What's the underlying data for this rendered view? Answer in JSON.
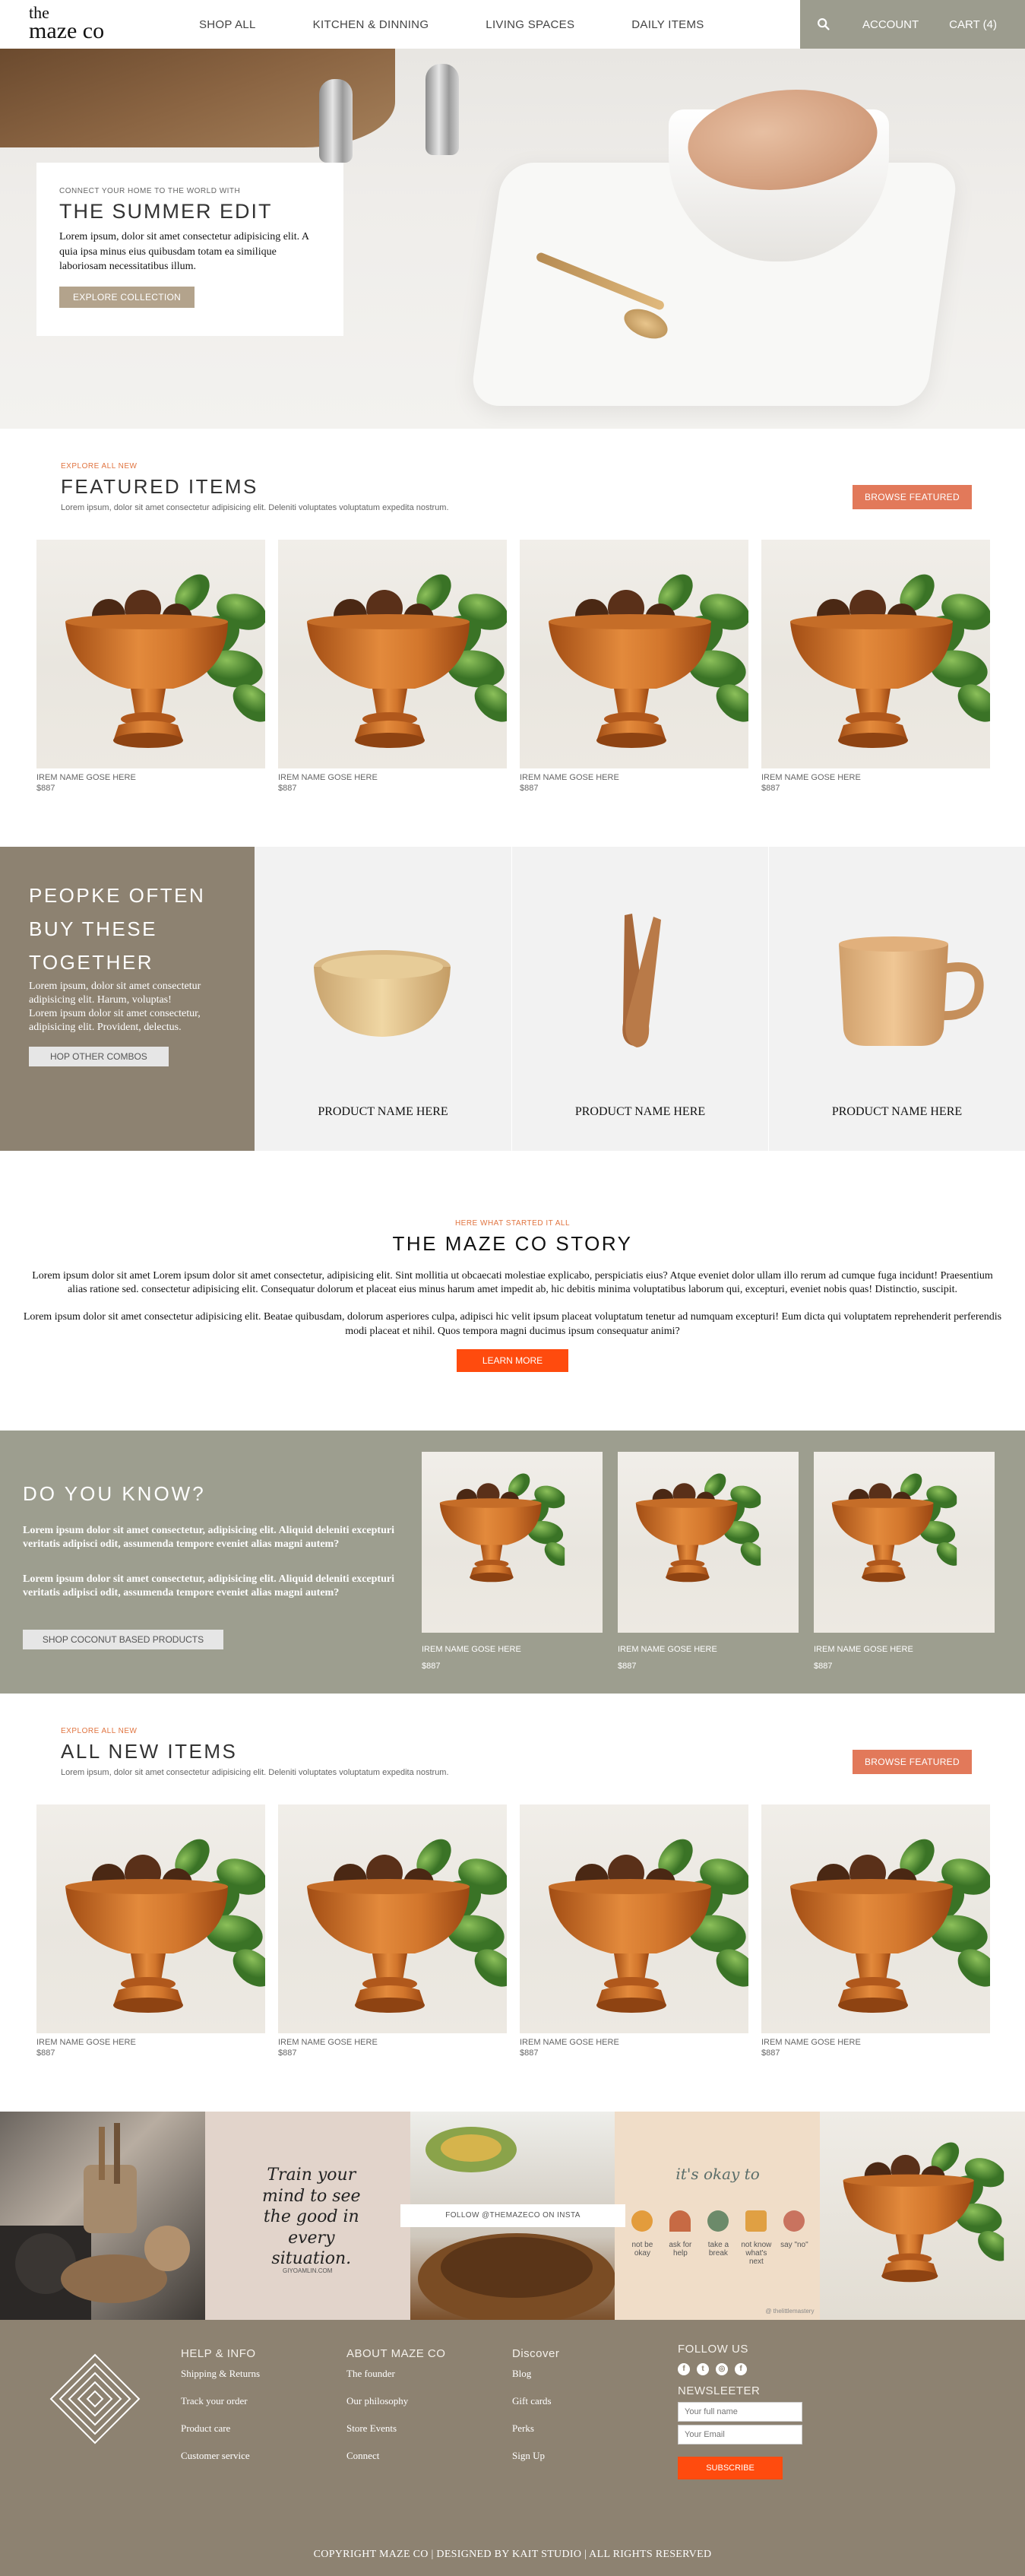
{
  "brand": {
    "logo_line1": "the",
    "logo_line2": "maze co"
  },
  "nav": [
    {
      "label": "SHOP ALL"
    },
    {
      "label": "KITCHEN & DINNING"
    },
    {
      "label": "LIVING SPACES"
    },
    {
      "label": "DAILY ITEMS"
    }
  ],
  "header_actions": {
    "account": "ACCOUNT",
    "cart": "CART (4)"
  },
  "hero": {
    "eyebrow": "CONNECT YOUR HOME TO THE WORLD WITH",
    "title": "THE SUMMER EDIT",
    "body": "Lorem ipsum, dolor sit amet consectetur adipisicing elit. A quia ipsa minus eius quibusdam totam ea similique laboriosam necessitatibus illum.",
    "button": "EXPLORE COLLECTION"
  },
  "featured": {
    "eyebrow": "EXPLORE ALL NEW",
    "title": "FEATURED ITEMS",
    "subtitle": "Lorem ipsum, dolor sit amet consectetur adipisicing elit. Deleniti voluptates voluptatum expedita nostrum.",
    "button": "BROWSE FEATURED",
    "products": [
      {
        "name": "IREM NAME GOSE HERE",
        "price": "$887"
      },
      {
        "name": "IREM NAME GOSE HERE",
        "price": "$887"
      },
      {
        "name": "IREM NAME GOSE HERE",
        "price": "$887"
      },
      {
        "name": "IREM NAME GOSE HERE",
        "price": "$887"
      }
    ]
  },
  "together": {
    "title_line1": "PEOPKE OFTEN",
    "title_line2": "BUY THESE",
    "title_line3": "TOGETHER",
    "body1": "Lorem ipsum, dolor sit amet consectetur adipisicing elit. Harum, voluptas!",
    "body2": "Lorem ipsum dolor sit amet consectetur, adipisicing elit. Provident, delectus.",
    "button": "HOP OTHER COMBOS",
    "products": [
      {
        "name": "PRODUCT NAME HERE"
      },
      {
        "name": "PRODUCT NAME HERE"
      },
      {
        "name": "PRODUCT NAME HERE"
      }
    ]
  },
  "story": {
    "eyebrow": "HERE WHAT STARTED IT ALL",
    "title": "THE MAZE CO STORY",
    "para1": "Lorem ipsum dolor sit amet Lorem ipsum dolor sit amet consectetur, adipisicing elit. Sint mollitia ut obcaecati molestiae explicabo, perspiciatis eius? Atque eveniet dolor ullam illo rerum ad cumque fuga incidunt! Praesentium alias ratione sed. consectetur adipisicing elit. Consequatur dolorum et placeat eius minus harum amet impedit ab, hic debitis minima voluptatibus laborum qui, excepturi, eveniet nobis quas! Distinctio, suscipit.",
    "para2": "Lorem ipsum dolor sit amet consectetur adipisicing elit. Beatae quibusdam, dolorum asperiores culpa, adipisci hic velit ipsum placeat voluptatum tenetur ad numquam excepturi! Eum dicta qui voluptatem reprehenderit perferendis modi placeat et nihil. Quos tempora magni ducimus ipsum consequatur animi?",
    "button": "LEARN MORE"
  },
  "know": {
    "title": "DO YOU KNOW?",
    "para1": "Lorem ipsum dolor sit amet consectetur, adipisicing elit. Aliquid deleniti excepturi veritatis adipisci odit, assumenda tempore eveniet alias magni autem?",
    "para2": "Lorem ipsum dolor sit amet consectetur, adipisicing elit. Aliquid deleniti excepturi veritatis adipisci odit, assumenda tempore eveniet alias magni autem?",
    "button": "SHOP COCONUT BASED PRODUCTS",
    "products": [
      {
        "name": "IREM NAME GOSE HERE",
        "price": "$887"
      },
      {
        "name": "IREM NAME GOSE HERE",
        "price": "$887"
      },
      {
        "name": "IREM NAME GOSE HERE",
        "price": "$887"
      }
    ]
  },
  "new_items": {
    "eyebrow": "EXPLORE ALL NEW",
    "title": "ALL NEW ITEMS",
    "subtitle": "Lorem ipsum, dolor sit amet consectetur adipisicing elit. Deleniti voluptates voluptatum expedita nostrum.",
    "button": "BROWSE FEATURED",
    "products": [
      {
        "name": "IREM NAME GOSE HERE",
        "price": "$887"
      },
      {
        "name": "IREM NAME GOSE HERE",
        "price": "$887"
      },
      {
        "name": "IREM NAME GOSE HERE",
        "price": "$887"
      },
      {
        "name": "IREM NAME GOSE HERE",
        "price": "$887"
      }
    ]
  },
  "insta": {
    "banner": "FOLLOW @THEMAZECO ON INSTA",
    "quote": "Train your mind to see the good in every situation.",
    "quote_credit": "GIYOAMLIN.COM",
    "okay_title": "it's okay to",
    "okay_items": [
      "not be okay",
      "ask for help",
      "take a break",
      "not know what's next",
      "say \"no\""
    ],
    "okay_credit": "@ thelittlemastery"
  },
  "footer": {
    "col1": {
      "title": "HELP & INFO",
      "links": [
        "Shipping & Returns",
        "Track your order",
        "Product care",
        "Customer service"
      ]
    },
    "col2": {
      "title": "ABOUT MAZE CO",
      "links": [
        "The founder",
        "Our philosophy",
        "Store Events",
        "Connect"
      ]
    },
    "col3": {
      "title": "Discover",
      "links": [
        "Blog",
        "Gift cards",
        "Perks",
        "Sign Up"
      ]
    },
    "follow_title": "FOLLOW US",
    "newsletter_title": "NEWSLEETER",
    "name_placeholder": "Your full name",
    "email_placeholder": "Your Email",
    "subscribe": "SUBSCRIBE",
    "copyright": "COPYRIGHT MAZE CO | DESIGNED BY KAIT STUDIO | ALL RIGHTS RESERVED"
  },
  "colors": {
    "header_block": "#9c9c8e",
    "taupe": "#8d8271",
    "coral": "#e2795a",
    "red_orange": "#ff4b0e",
    "sage": "#9d9e8f"
  }
}
